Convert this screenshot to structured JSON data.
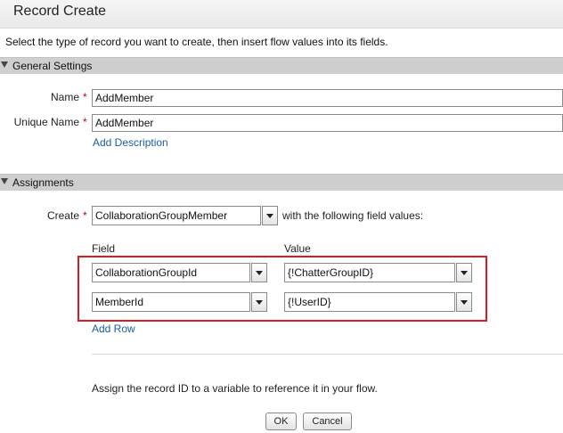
{
  "window": {
    "title": "Record Create"
  },
  "description": "Select the type of record you want to create, then insert flow values into its fields.",
  "general": {
    "header": "General Settings",
    "name_label": "Name",
    "name_value": "AddMember",
    "unique_label": "Unique Name",
    "unique_value": "AddMember",
    "add_description": "Add Description"
  },
  "assignments": {
    "header": "Assignments",
    "create_label": "Create",
    "object_value": "CollaborationGroupMember",
    "with_text": "with the following field values:",
    "field_header": "Field",
    "value_header": "Value",
    "rows": [
      {
        "field": "CollaborationGroupId",
        "value": "{!ChatterGroupID}"
      },
      {
        "field": "MemberId",
        "value": "{!UserID}"
      }
    ],
    "add_row": "Add Row",
    "assign_id_text": "Assign the record ID to a variable to reference it in your flow."
  },
  "buttons": {
    "ok": "OK",
    "cancel": "Cancel"
  },
  "colors": {
    "required": "#cc0000",
    "link": "#1a5ea8",
    "highlight": "#d71d24",
    "section": "#cfcfcf"
  }
}
